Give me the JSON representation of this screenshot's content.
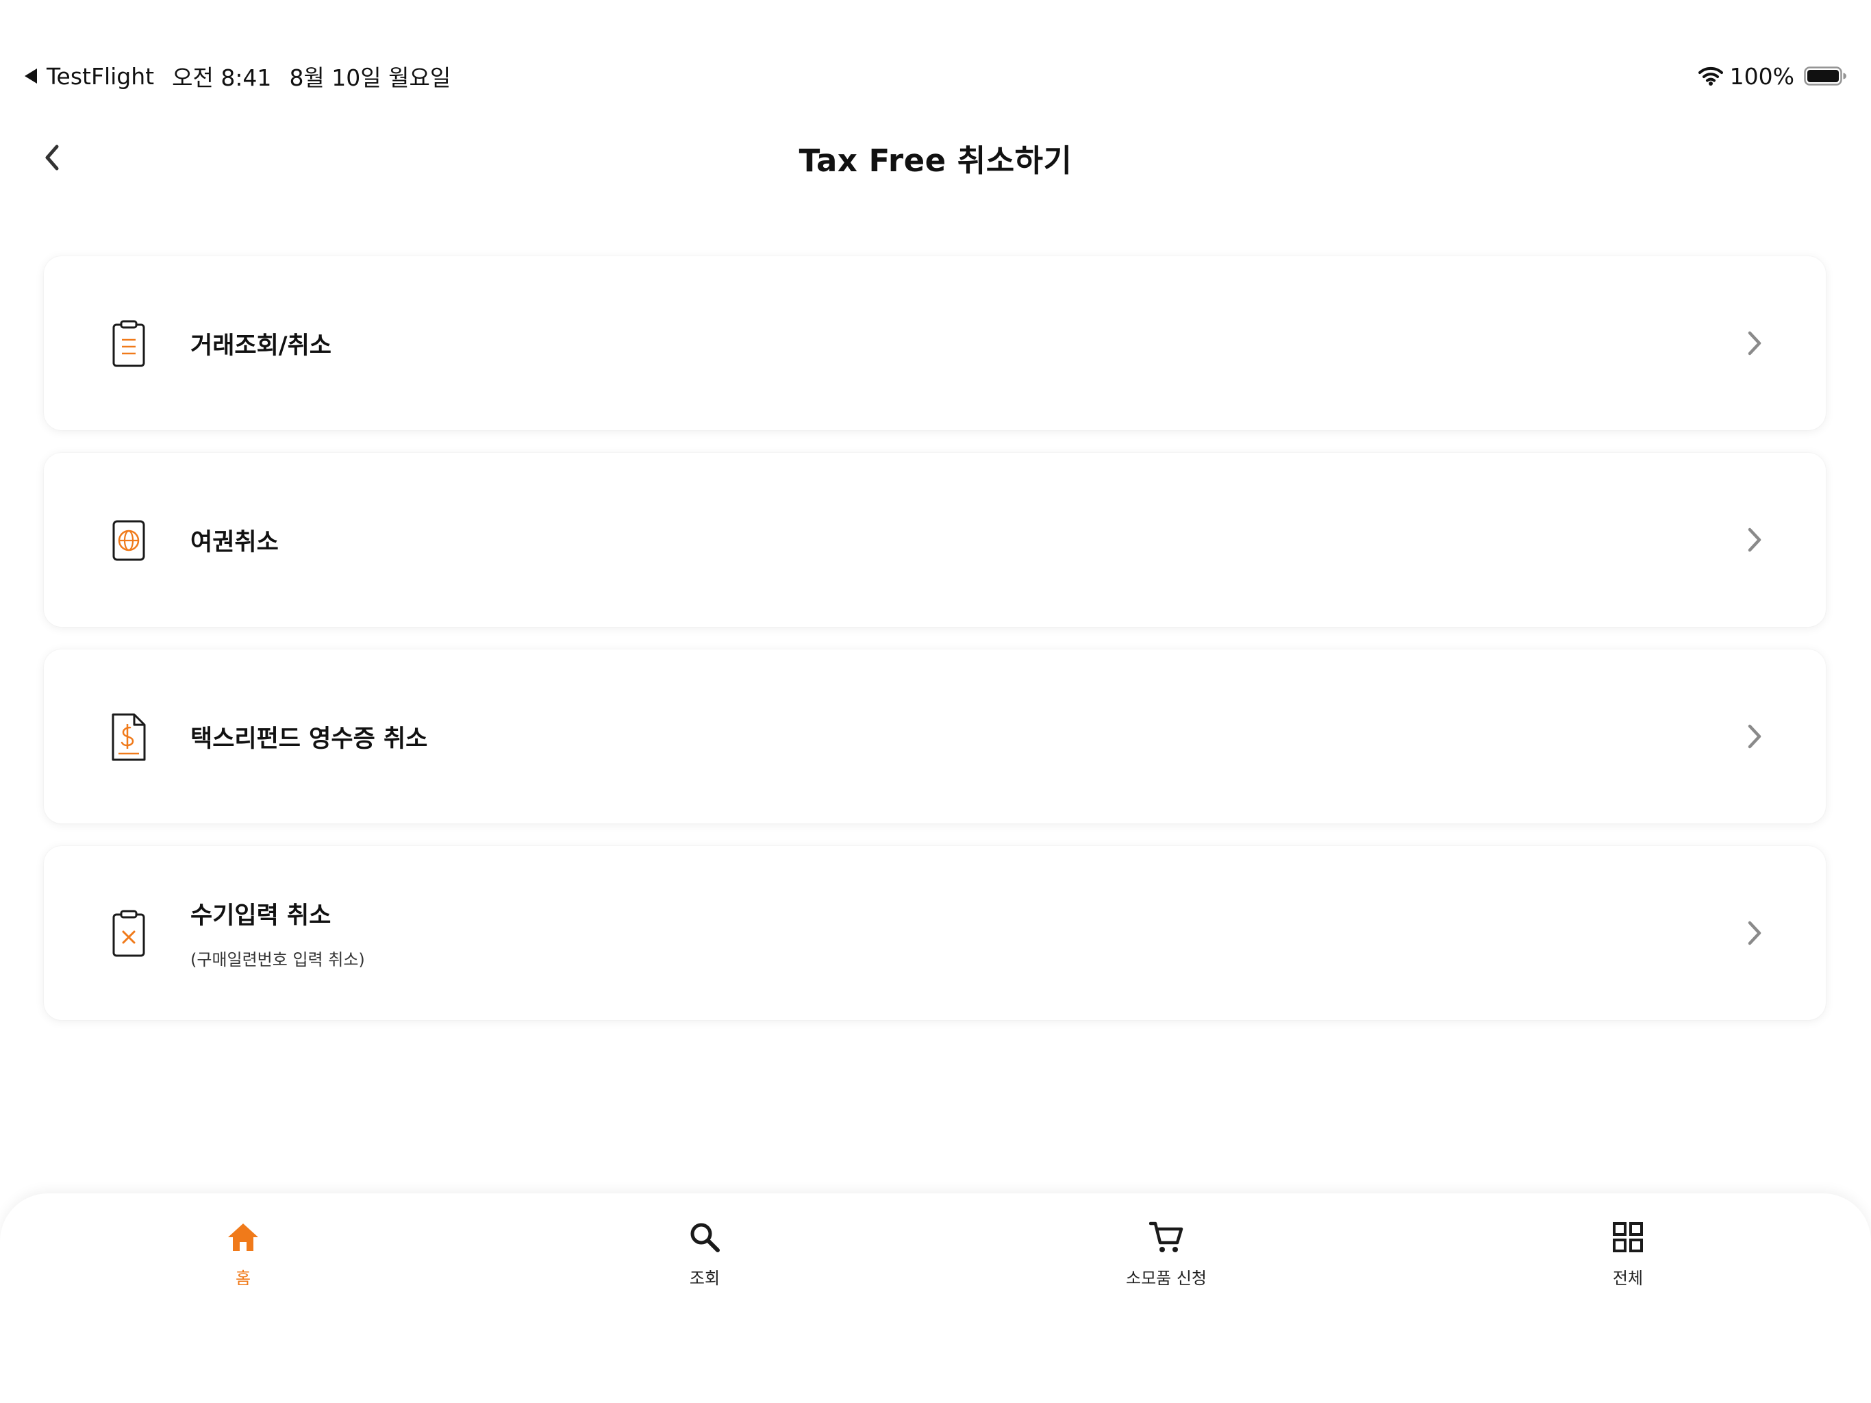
{
  "status_bar": {
    "back_app": "TestFlight",
    "time": "오전 8:41",
    "date": "8월 10일 월요일",
    "battery": "100%"
  },
  "header": {
    "title": "Tax Free 취소하기"
  },
  "menu": {
    "items": [
      {
        "label": "거래조회/취소",
        "sublabel": "",
        "icon": "clipboard-list-icon"
      },
      {
        "label": "여권취소",
        "sublabel": "",
        "icon": "passport-globe-icon"
      },
      {
        "label": "택스리펀드 영수증 취소",
        "sublabel": "",
        "icon": "receipt-dollar-icon"
      },
      {
        "label": "수기입력 취소",
        "sublabel": "(구매일련번호 입력 취소)",
        "icon": "clipboard-x-icon"
      }
    ]
  },
  "tab_bar": {
    "tabs": [
      {
        "label": "홈",
        "icon": "home-icon",
        "active": true
      },
      {
        "label": "조회",
        "icon": "search-icon",
        "active": false
      },
      {
        "label": "소모품 신청",
        "icon": "cart-icon",
        "active": false
      },
      {
        "label": "전체",
        "icon": "grid-icon",
        "active": false
      }
    ]
  },
  "colors": {
    "accent": "#f07a1a",
    "text": "#111111",
    "icon_stroke": "#1a1a1a",
    "chevron": "#8a8a8a"
  }
}
